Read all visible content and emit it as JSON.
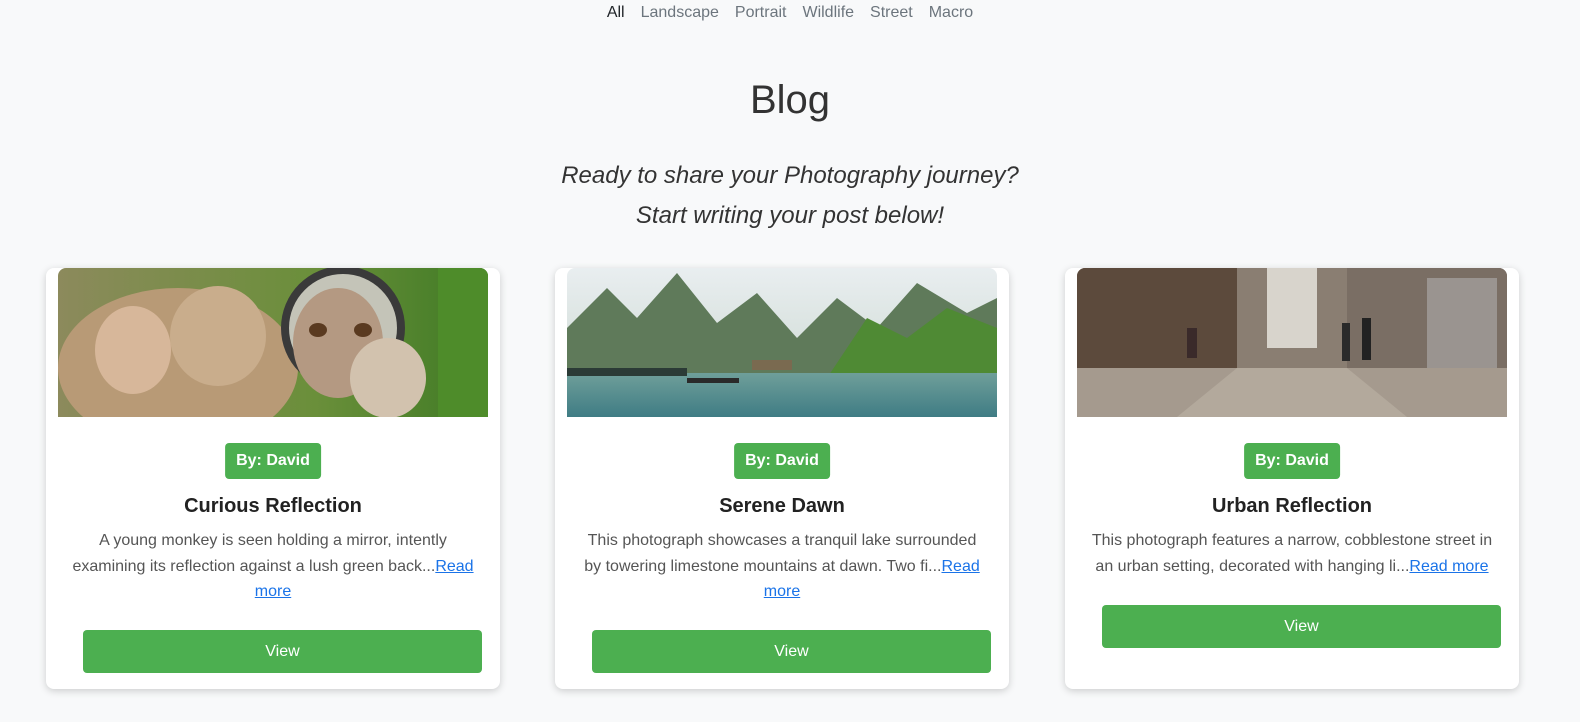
{
  "filters": [
    "All",
    "Landscape",
    "Portrait",
    "Wildlife",
    "Street",
    "Macro"
  ],
  "active_filter": "All",
  "header": {
    "title": "Blog",
    "tagline_line1": "Ready to share your Photography journey?",
    "tagline_line2": "Start writing your post below!"
  },
  "colors": {
    "accent": "#4caf50",
    "link": "#1a73e8",
    "background": "#f8f9fa"
  },
  "cards": [
    {
      "image": "monkey-mirror-photo",
      "author": "By: David",
      "title": "Curious Reflection",
      "excerpt": "A young monkey is seen holding a mirror, intently examining its reflection against a lush green back...",
      "read_more": "Read more",
      "button": "View"
    },
    {
      "image": "lake-mountains-dawn-photo",
      "author": "By: David",
      "title": "Serene Dawn",
      "excerpt": "This photograph showcases a tranquil lake surrounded by towering limestone mountains at dawn. Two fi...",
      "read_more": "Read more",
      "button": "View"
    },
    {
      "image": "cobblestone-street-photo",
      "author": "By: David",
      "title": "Urban Reflection",
      "excerpt": "This photograph features a narrow, cobblestone street in an urban setting, decorated with hanging li...",
      "read_more": "Read more",
      "button": "View"
    }
  ]
}
